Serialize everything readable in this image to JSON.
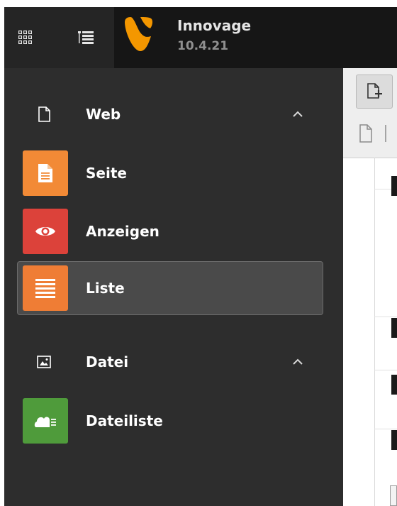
{
  "topbar": {
    "site_name": "Innovage",
    "site_version": "10.4.21",
    "icons": [
      "app-grid-icon",
      "module-menu-toggle-icon",
      "typo3-logo"
    ],
    "colors": {
      "logo_orange": "#f49700",
      "bar_bg": "#161616"
    }
  },
  "sidebar": {
    "groups": [
      {
        "label": "Web",
        "icon": "page-outline-icon",
        "expanded": true,
        "items": [
          {
            "label": "Seite",
            "icon": "page-document-icon",
            "color": "#f28a36",
            "active": false
          },
          {
            "label": "Anzeigen",
            "icon": "eye-icon",
            "color": "#dc423a",
            "active": false
          },
          {
            "label": "Liste",
            "icon": "list-lines-icon",
            "color": "#ef7d35",
            "active": true
          }
        ]
      },
      {
        "label": "Datei",
        "icon": "image-file-icon",
        "expanded": true,
        "items": [
          {
            "label": "Dateiliste",
            "icon": "cloud-list-icon",
            "color": "#4f9b3b",
            "active": false
          }
        ]
      }
    ]
  }
}
